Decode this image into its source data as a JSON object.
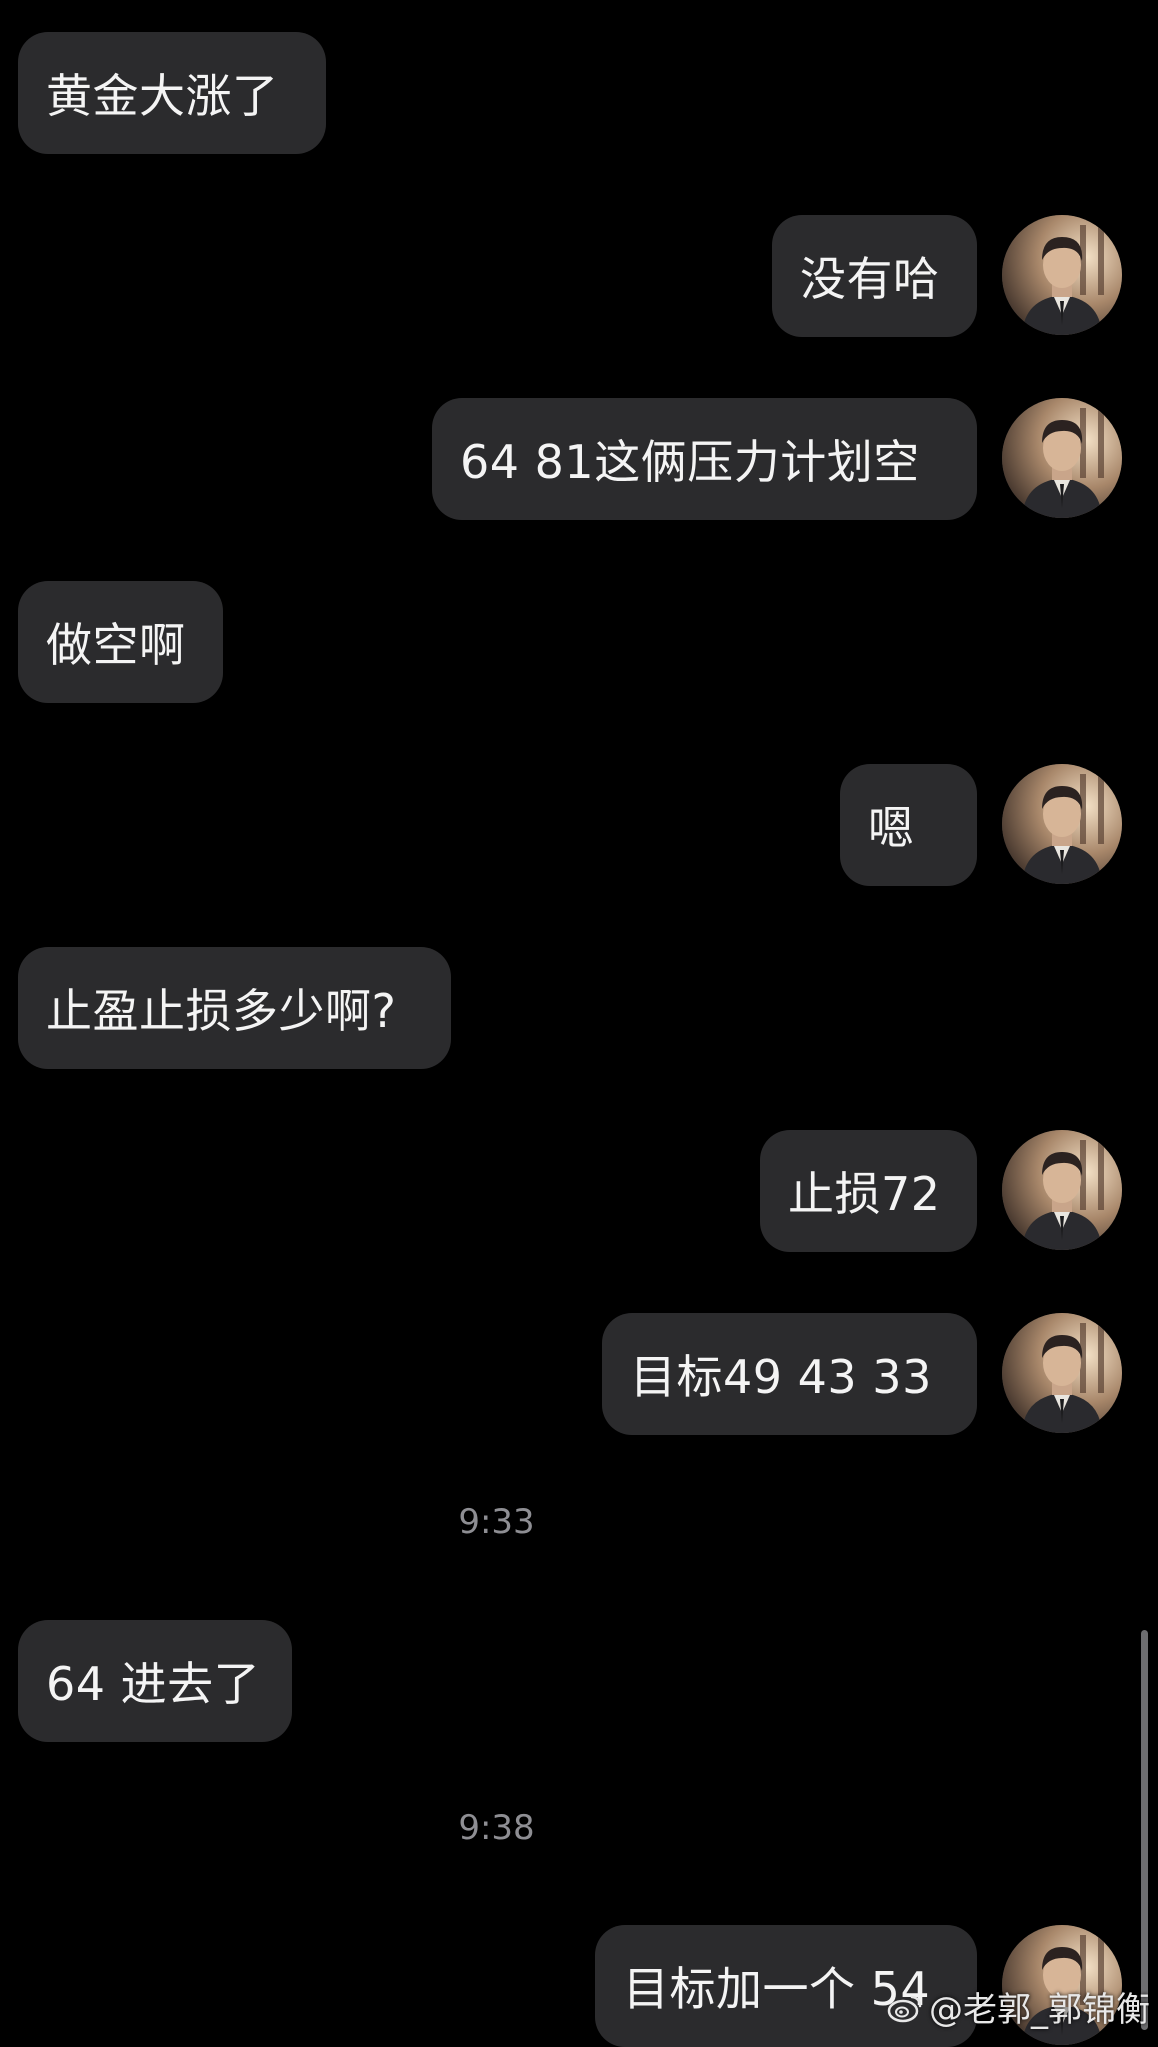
{
  "messages": [
    {
      "side": "in",
      "text": "黄金大涨了"
    },
    {
      "side": "out",
      "text": "没有哈"
    },
    {
      "side": "out",
      "text": "64 81这俩压力计划空"
    },
    {
      "side": "in",
      "text": "做空啊"
    },
    {
      "side": "out",
      "text": "嗯"
    },
    {
      "side": "in",
      "text": "止盈止损多少啊?"
    },
    {
      "side": "out",
      "text": "止损72"
    },
    {
      "side": "out",
      "text": "目标49 43 33"
    },
    {
      "side": "time",
      "text": "9:33"
    },
    {
      "side": "in",
      "text": "64 进去了"
    },
    {
      "side": "time",
      "text": "9:38"
    },
    {
      "side": "out",
      "text": "目标加一个 54"
    }
  ],
  "watermark": {
    "handle": "@老郭_郭锦衡",
    "icon": "weibo-logo-icon"
  },
  "colors": {
    "background": "#000000",
    "bubble": "#2b2b2d",
    "text": "#f4f4f4",
    "timestamp": "#8e8e93"
  }
}
